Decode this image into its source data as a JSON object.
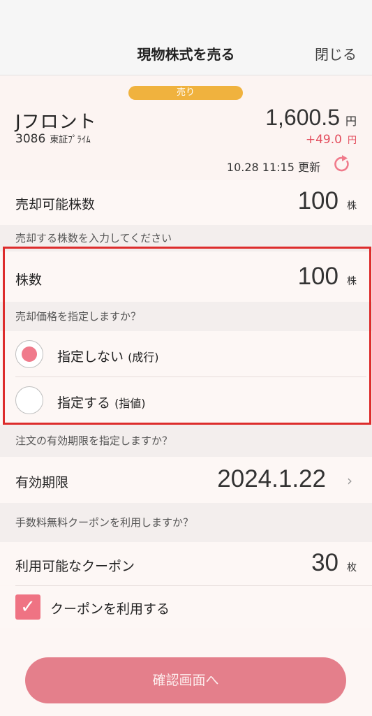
{
  "header": {
    "title": "現物株式を売る",
    "close_label": "閉じる"
  },
  "stock": {
    "badge": "売り",
    "name": "Jフロント",
    "code": "3086",
    "market": "東証ﾌﾟﾗｲﾑ",
    "price": "1,600.5",
    "price_unit": "円",
    "change": "+49.0",
    "change_unit": "円",
    "updated": "10.28 11:15 更新"
  },
  "sellable": {
    "label": "売却可能株数",
    "value": "100",
    "unit": "株"
  },
  "prompts": {
    "enter_shares": "売却する株数を入力してください",
    "price_type": "売却価格を指定しますか？",
    "expiry": "注文の有効期限を指定しますか？",
    "coupon": "手数料無料クーポンを利用しますか？"
  },
  "shares": {
    "label": "株数",
    "value": "100",
    "unit": "株"
  },
  "price_options": [
    {
      "label": "指定しない",
      "sub": "(成行)",
      "selected": true
    },
    {
      "label": "指定する",
      "sub": "(指値)",
      "selected": false
    }
  ],
  "expiry": {
    "label": "有効期限",
    "value": "2024.1.22"
  },
  "coupon": {
    "label": "利用可能なクーポン",
    "value": "30",
    "unit": "枚",
    "use_label": "クーポンを利用する",
    "use_checked": true
  },
  "confirm_label": "確認画面へ",
  "colors": {
    "accent": "#ef7383",
    "badge": "#f0b23e",
    "up": "#e34c5c",
    "highlight_border": "#dd2c2c"
  }
}
